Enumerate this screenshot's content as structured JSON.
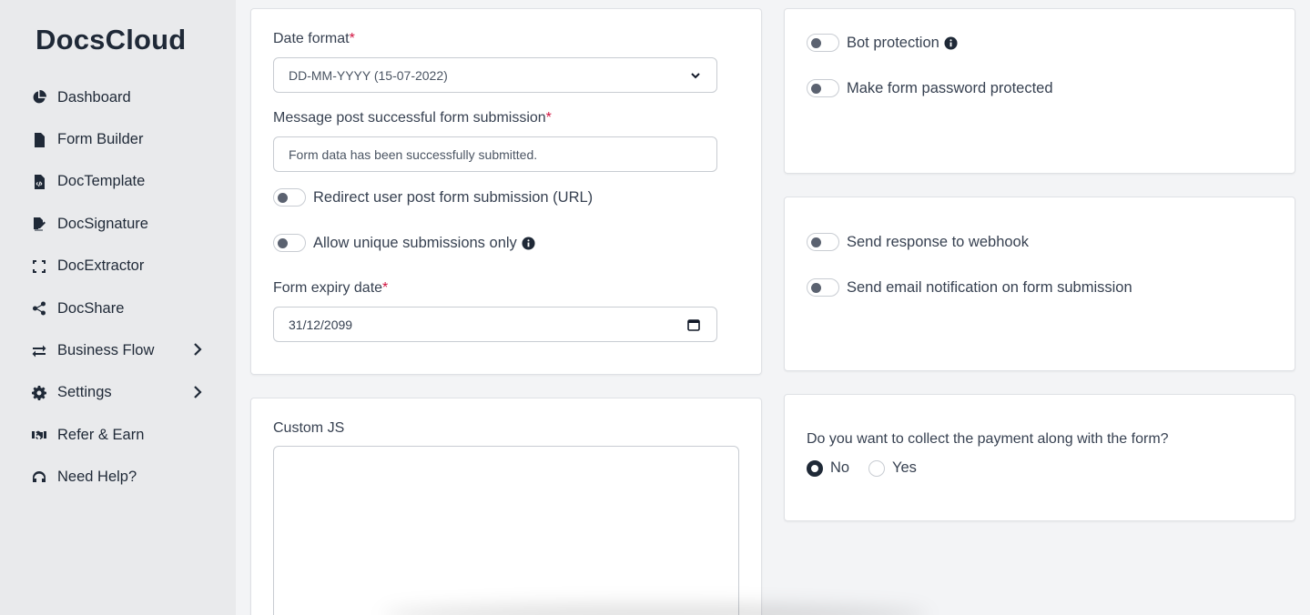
{
  "brand": "DocsCloud",
  "sidebar": {
    "items": [
      {
        "label": "Dashboard",
        "icon": "pie-chart-icon",
        "has_submenu": false
      },
      {
        "label": "Form Builder",
        "icon": "file-text-icon",
        "has_submenu": false
      },
      {
        "label": "DocTemplate",
        "icon": "file-code-icon",
        "has_submenu": false
      },
      {
        "label": "DocSignature",
        "icon": "signature-icon",
        "has_submenu": false
      },
      {
        "label": "DocExtractor",
        "icon": "scan-icon",
        "has_submenu": false
      },
      {
        "label": "DocShare",
        "icon": "share-icon",
        "has_submenu": false
      },
      {
        "label": "Business Flow",
        "icon": "arrows-exchange-icon",
        "has_submenu": true
      },
      {
        "label": "Settings",
        "icon": "gear-icon",
        "has_submenu": true
      },
      {
        "label": "Refer & Earn",
        "icon": "handshake-icon",
        "has_submenu": false
      },
      {
        "label": "Need Help?",
        "icon": "headset-icon",
        "has_submenu": false
      }
    ]
  },
  "form_settings": {
    "date_format_label": "Date format",
    "date_format_value": "DD-MM-YYYY (15-07-2022)",
    "message_label": "Message post successful form submission",
    "message_placeholder": "Form data has been successfully submitted.",
    "redirect_label": "Redirect user post form submission (URL)",
    "redirect_on": false,
    "unique_label": "Allow unique submissions only",
    "unique_on": false,
    "expiry_label": "Form expiry date",
    "expiry_value": "31/12/2099",
    "required_mark": "*"
  },
  "security": {
    "bot_label": "Bot protection",
    "bot_on": false,
    "password_label": "Make form password protected",
    "password_on": false
  },
  "integrations": {
    "webhook_label": "Send response to webhook",
    "webhook_on": false,
    "email_label": "Send email notification on form submission",
    "email_on": false
  },
  "custom_js": {
    "label": "Custom JS",
    "value": ""
  },
  "payment": {
    "question": "Do you want to collect the payment along with the form?",
    "options": [
      "No",
      "Yes"
    ],
    "selected": "No"
  },
  "colors": {
    "required": "#d1123f",
    "text": "#1f2937",
    "sidebar_bg": "#e9eaec",
    "page_bg": "#f3f4f6"
  }
}
